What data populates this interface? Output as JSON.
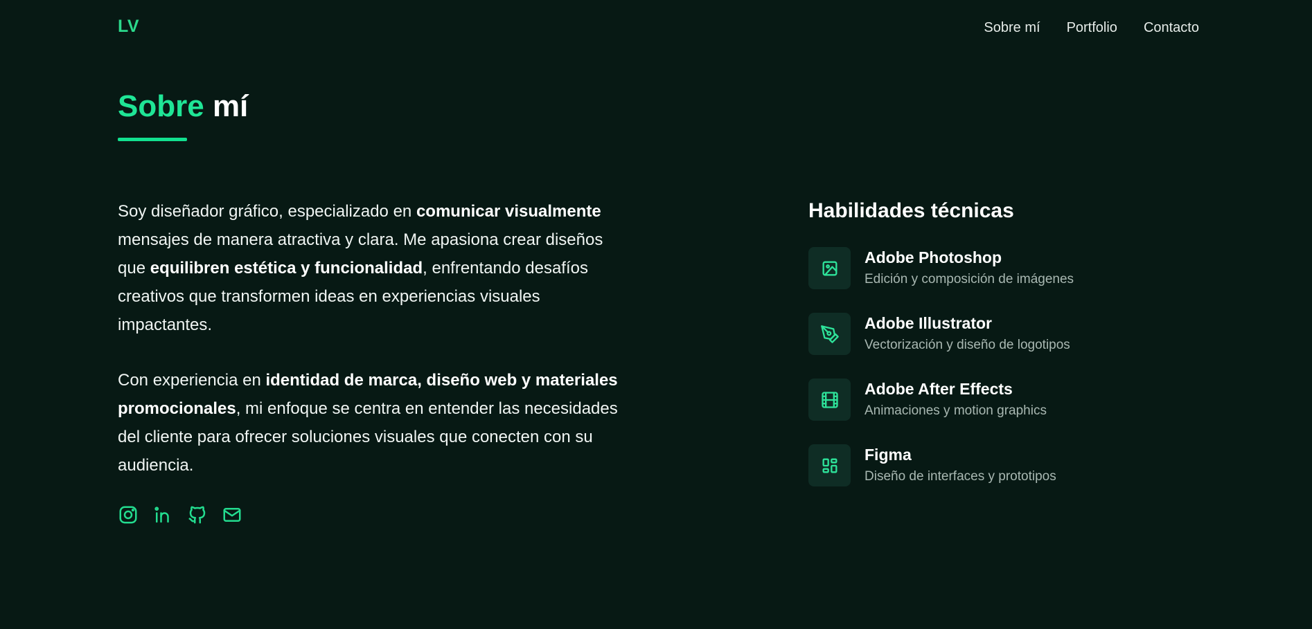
{
  "header": {
    "logo": "LV",
    "nav": [
      {
        "label": "Sobre mí"
      },
      {
        "label": "Portfolio"
      },
      {
        "label": "Contacto"
      }
    ]
  },
  "section": {
    "title_accent": "Sobre",
    "title_rest": "mí"
  },
  "about": {
    "p1": [
      {
        "text": "Soy diseñador gráfico, especializado en ",
        "bold": false
      },
      {
        "text": "comunicar visualmente",
        "bold": true
      },
      {
        "text": " mensajes de manera atractiva y clara. Me apasiona crear diseños que ",
        "bold": false
      },
      {
        "text": "equilibren estética y funcionalidad",
        "bold": true
      },
      {
        "text": ", enfrentando desafíos creativos que transformen ideas en experiencias visuales impactantes.",
        "bold": false
      }
    ],
    "p2": [
      {
        "text": "Con experiencia en ",
        "bold": false
      },
      {
        "text": "identidad de marca, diseño web y materiales promocionales",
        "bold": true
      },
      {
        "text": ", mi enfoque se centra en entender las necesidades del cliente para ofrecer soluciones visuales que conecten con su audiencia.",
        "bold": false
      }
    ]
  },
  "socials": [
    {
      "name": "instagram-icon"
    },
    {
      "name": "linkedin-icon"
    },
    {
      "name": "github-icon"
    },
    {
      "name": "mail-icon"
    }
  ],
  "skills": {
    "title": "Habilidades técnicas",
    "items": [
      {
        "name": "Adobe Photoshop",
        "description": "Edición y composición de imágenes",
        "icon": "image-icon"
      },
      {
        "name": "Adobe Illustrator",
        "description": "Vectorización y diseño de logotipos",
        "icon": "pen-tool-icon"
      },
      {
        "name": "Adobe After Effects",
        "description": "Animaciones y motion graphics",
        "icon": "film-icon"
      },
      {
        "name": "Figma",
        "description": "Diseño de interfaces y prototipos",
        "icon": "layout-icon"
      }
    ]
  },
  "colors": {
    "background": "#071914",
    "accent": "#1fe596",
    "icon_tile": "#0f2d25",
    "muted_text": "#a9b8b2"
  }
}
